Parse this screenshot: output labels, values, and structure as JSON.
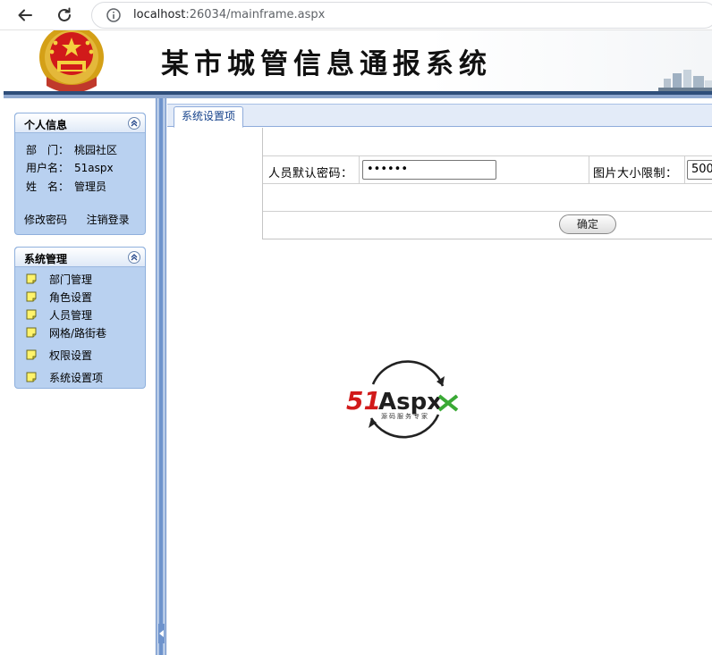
{
  "browser": {
    "url_host": "localhost",
    "url_path": ":26034/mainframe.aspx"
  },
  "banner": {
    "title": "某市城管信息通报系统"
  },
  "personal_panel": {
    "title": "个人信息",
    "department_label": "部　门：",
    "department_value": "桃园社区",
    "username_label": "用户名：",
    "username_value": "51aspx",
    "name_label": "姓　名：",
    "name_value": "管理员",
    "change_password": "修改密码",
    "logout": "注销登录"
  },
  "system_panel": {
    "title": "系统管理",
    "items": [
      {
        "label": "部门管理"
      },
      {
        "label": "角色设置"
      },
      {
        "label": "人员管理"
      },
      {
        "label": "网格/路街巷"
      },
      {
        "label": "权限设置"
      },
      {
        "label": "系统设置项"
      }
    ]
  },
  "main": {
    "tab_label": "系统设置项",
    "default_password_label": "人员默认密码：",
    "default_password_value": "••••••",
    "image_limit_label": "图片大小限制：",
    "image_limit_value": "500",
    "confirm_label": "确定"
  },
  "watermark": {
    "brand_51": "51",
    "brand_aspx": "Aspx",
    "tagline": "源码服务专家"
  },
  "colors": {
    "accent_blue": "#15428b",
    "panel_bg": "#b9d1f0",
    "splitter": "#6e93cc",
    "brand_red": "#d11a1a",
    "brand_green": "#3aa935"
  }
}
